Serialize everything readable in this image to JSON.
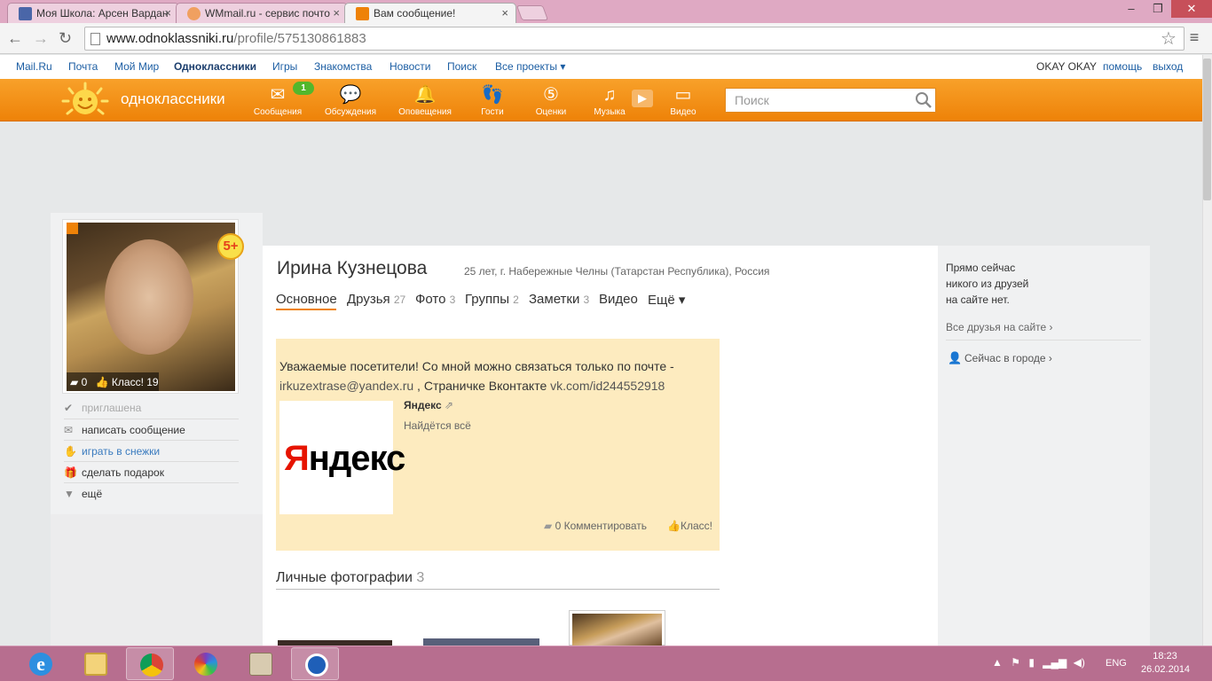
{
  "browser": {
    "tabs": [
      {
        "label": "Моя Школа: Арсен Вардан",
        "icon": "myschool-favicon",
        "color": "#4a66a8"
      },
      {
        "label": "WMmail.ru - сервис почто",
        "icon": "wmmail-favicon",
        "color": "#f0a060"
      },
      {
        "label": "Вам сообщение!",
        "icon": "ok-favicon",
        "color": "#ee8208"
      }
    ],
    "url_host": "www.odnoklassniki.ru",
    "url_path": "/profile/575130861883"
  },
  "portal": {
    "links": [
      "Mail.Ru",
      "Почта",
      "Мой Мир",
      "Одноклассники",
      "Игры",
      "Знакомства",
      "Новости",
      "Поиск",
      "Все проекты ▾"
    ],
    "user": "OKAY OKAY",
    "help": "помощь",
    "logout": "выход"
  },
  "header": {
    "brand": "одноклассники",
    "nav": [
      {
        "label": "Сообщения",
        "icon": "envelope-icon"
      },
      {
        "label": "Обсуждения",
        "icon": "discussions-icon"
      },
      {
        "label": "Оповещения",
        "icon": "bell-icon"
      },
      {
        "label": "Гости",
        "icon": "footprints-icon"
      },
      {
        "label": "Оценки",
        "icon": "ratings-icon"
      },
      {
        "label": "Музыка",
        "icon": "music-icon"
      },
      {
        "label": "Видео",
        "icon": "video-icon"
      }
    ],
    "messages_badge": "1",
    "search_placeholder": "Поиск",
    "accent": "#ee8208"
  },
  "profile": {
    "name": "Ирина Кузнецова",
    "info": "25 лет, г. Набережные Челны (Татарстан Республика), Россия",
    "rating_badge": "5+",
    "comments_count": "0",
    "klass_label": "Класс! 19",
    "actions": [
      {
        "label": "приглашена",
        "icon": "check-icon"
      },
      {
        "label": "написать сообщение",
        "icon": "envelope-icon"
      },
      {
        "label": "играть в снежки",
        "icon": "mitten-icon"
      },
      {
        "label": "сделать подарок",
        "icon": "gift-icon"
      },
      {
        "label": "ещё",
        "icon": "triangle-down-icon"
      }
    ],
    "tabs": [
      {
        "label": "Основное",
        "count": ""
      },
      {
        "label": "Друзья",
        "count": "27"
      },
      {
        "label": "Фото",
        "count": "3"
      },
      {
        "label": "Группы",
        "count": "2"
      },
      {
        "label": "Заметки",
        "count": "3"
      },
      {
        "label": "Видео",
        "count": ""
      },
      {
        "label": "Ещё ▾",
        "count": ""
      }
    ]
  },
  "note": {
    "text1": "Уважаемые посетители! Со мной можно связаться только по почте -",
    "email": "irkuzextrase@yandex.ru",
    "text2": " , Страничке Вконтакте ",
    "vk": "vk.com/id244552918",
    "link_title": "Яндекс",
    "link_desc": "Найдётся всё",
    "logo_first": "Я",
    "logo_rest": "ндекс",
    "comments": "0 Комментировать",
    "klass": "Класс!"
  },
  "photos": {
    "heading": "Личные фотографии",
    "count": "3"
  },
  "right": {
    "status_line1": "Прямо сейчас",
    "status_line2": "никого из друзей",
    "status_line3": "на сайте нет.",
    "friends_link": "Все друзья на сайте ›",
    "city_link": "Сейчас в городе ›"
  },
  "taskbar": {
    "lang": "ENG",
    "time": "18:23",
    "date": "26.02.2014"
  }
}
